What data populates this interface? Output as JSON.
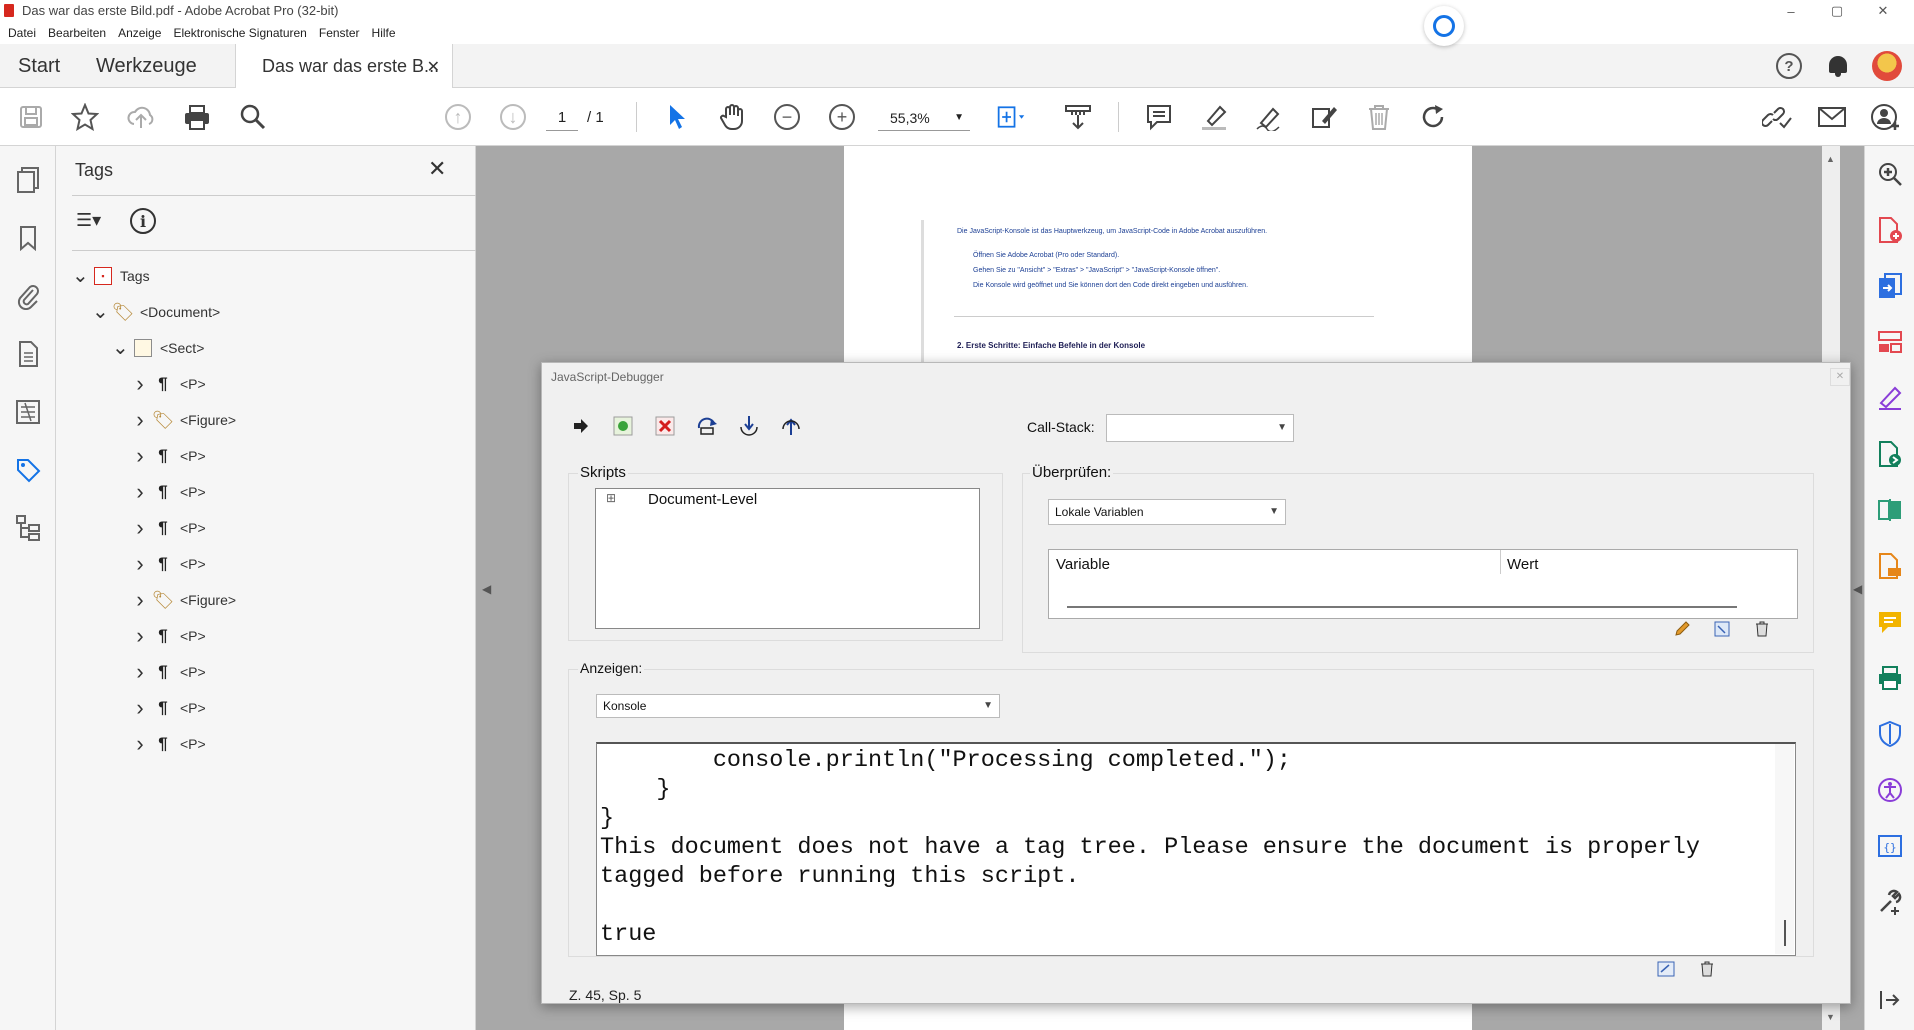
{
  "window": {
    "title": "Das war das erste Bild.pdf - Adobe Acrobat Pro (32-bit)",
    "controls": [
      "–",
      "▢",
      "✕"
    ]
  },
  "menu": [
    "Datei",
    "Bearbeiten",
    "Anzeige",
    "Elektronische Signaturen",
    "Fenster",
    "Hilfe"
  ],
  "tabs": {
    "start": "Start",
    "tools": "Werkzeuge",
    "doc": "Das war das erste B...",
    "doc_close": "✕"
  },
  "header_icons": [
    "help-icon",
    "bell-icon",
    "avatar"
  ],
  "toolbar": {
    "page_current": "1",
    "page_total": "/ 1",
    "zoom": "55,3%"
  },
  "tags_panel": {
    "title": "Tags",
    "close": "✕",
    "tree": [
      {
        "label": "Tags",
        "level": 0,
        "expanded": true,
        "icon": "pdf-icon"
      },
      {
        "label": "<Document>",
        "level": 1,
        "expanded": true,
        "icon": "tag-icon"
      },
      {
        "label": "<Sect>",
        "level": 2,
        "expanded": true,
        "icon": "sect-icon"
      },
      {
        "label": "<P>",
        "level": 3,
        "expanded": false,
        "icon": "paragraph-icon"
      },
      {
        "label": "<Figure>",
        "level": 3,
        "expanded": false,
        "icon": "tag-icon"
      },
      {
        "label": "<P>",
        "level": 3,
        "expanded": false,
        "icon": "paragraph-icon"
      },
      {
        "label": "<P>",
        "level": 3,
        "expanded": false,
        "icon": "paragraph-icon"
      },
      {
        "label": "<P>",
        "level": 3,
        "expanded": false,
        "icon": "paragraph-icon"
      },
      {
        "label": "<P>",
        "level": 3,
        "expanded": false,
        "icon": "paragraph-icon"
      },
      {
        "label": "<Figure>",
        "level": 3,
        "expanded": false,
        "icon": "tag-icon"
      },
      {
        "label": "<P>",
        "level": 3,
        "expanded": false,
        "icon": "paragraph-icon"
      },
      {
        "label": "<P>",
        "level": 3,
        "expanded": false,
        "icon": "paragraph-icon"
      },
      {
        "label": "<P>",
        "level": 3,
        "expanded": false,
        "icon": "paragraph-icon"
      },
      {
        "label": "<P>",
        "level": 3,
        "expanded": false,
        "icon": "paragraph-icon"
      }
    ]
  },
  "page_content": {
    "intro": "Die JavaScript-Konsole ist das Hauptwerkzeug, um JavaScript-Code in Adobe Acrobat auszuführen.",
    "bullets": [
      "Öffnen Sie Adobe Acrobat (Pro oder Standard).",
      "Gehen Sie zu \"Ansicht\" > \"Extras\" > \"JavaScript\" > \"JavaScript-Konsole öffnen\".",
      "Die Konsole wird geöffnet und Sie können dort den Code direkt eingeben und ausführen."
    ],
    "heading": "2. Erste Schritte: Einfache Befehle in der Konsole"
  },
  "debugger": {
    "title": "JavaScript-Debugger",
    "close": "✕",
    "callstack_label": "Call-Stack:",
    "callstack_value": "",
    "scripts_label": "Skripts",
    "scripts_items": [
      {
        "expander": "⊞",
        "label": "Document-Level"
      }
    ],
    "inspect_label": "Überprüfen:",
    "inspect_value": "Lokale Variablen",
    "col_variable": "Variable",
    "col_value": "Wert",
    "show_label": "Anzeigen:",
    "show_value": "Konsole",
    "console_text": "        console.println(\"Processing completed.\");\n    }\n}\nThis document does not have a tag tree. Please ensure the document is properly\ntagged before running this script.\n\ntrue",
    "status": "Z. 45, Sp. 5"
  },
  "colors": {
    "accent_blue": "#1473e6",
    "acrobat_red": "#d6281e",
    "tag_gold": "#b78a3a"
  }
}
